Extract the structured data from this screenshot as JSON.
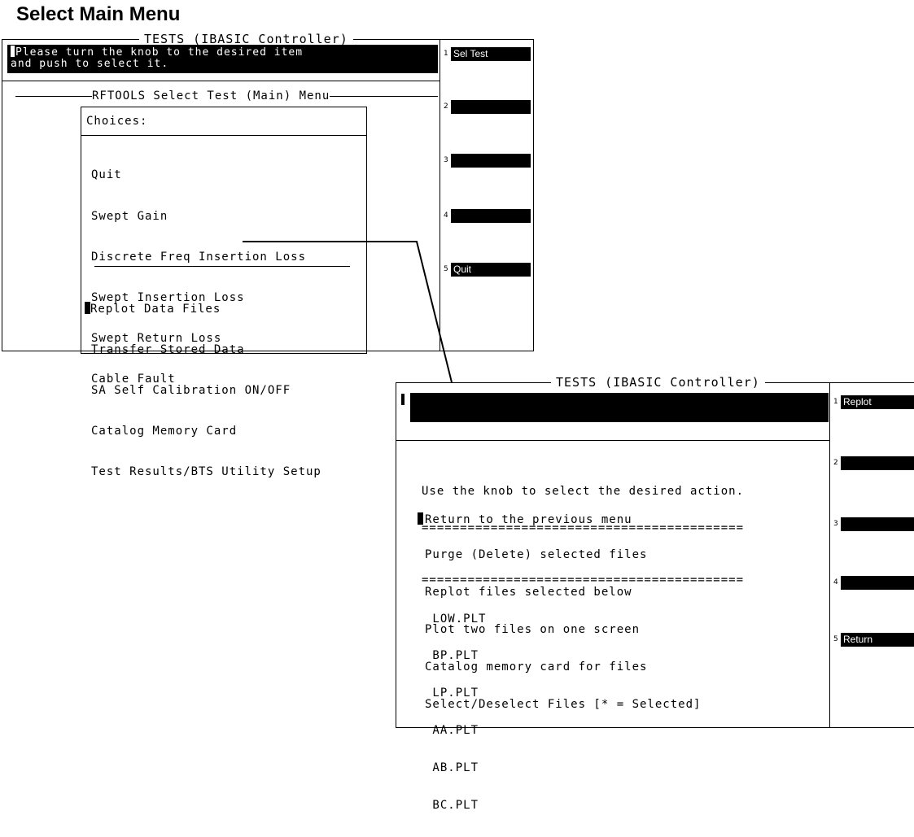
{
  "heading": "Select Main Menu",
  "screen1": {
    "title": "TESTS (IBASIC Controller)",
    "prompt_line1": "Please turn the knob to the desired item",
    "prompt_line2": "and push to select it.",
    "menu_title": "RFTOOLS Select Test (Main) Menu",
    "choices_label": "Choices:",
    "group1": [
      "Quit",
      "Swept Gain",
      "Discrete Freq Insertion Loss",
      "Swept Insertion Loss",
      "Swept Return Loss",
      "Cable Fault"
    ],
    "group2": [
      "Replot Data Files",
      "Transfer Stored Data",
      "SA Self Calibration ON/OFF",
      "Catalog Memory Card",
      "Test Results/BTS Utility Setup"
    ],
    "softkeys": [
      {
        "num": "1",
        "label": "Sel Test"
      },
      {
        "num": "2",
        "label": ""
      },
      {
        "num": "3",
        "label": ""
      },
      {
        "num": "4",
        "label": ""
      },
      {
        "num": "5",
        "label": "Quit"
      }
    ]
  },
  "screen2": {
    "title": "TESTS (IBASIC Controller)",
    "instruction": "Use the knob to select the desired action.",
    "separator": "==========================================",
    "actions": [
      "Return to the previous menu",
      "Purge (Delete) selected files",
      "Replot files selected below",
      "Plot two files on one screen",
      "Catalog memory card for files",
      "Select/Deselect Files [* = Selected]"
    ],
    "files": [
      " LOW.PLT",
      " BP.PLT",
      " LP.PLT",
      " AA.PLT",
      " AB.PLT",
      " BC.PLT"
    ],
    "softkeys": [
      {
        "num": "1",
        "label": "Replot"
      },
      {
        "num": "2",
        "label": ""
      },
      {
        "num": "3",
        "label": ""
      },
      {
        "num": "4",
        "label": ""
      },
      {
        "num": "5",
        "label": "Return"
      }
    ]
  }
}
